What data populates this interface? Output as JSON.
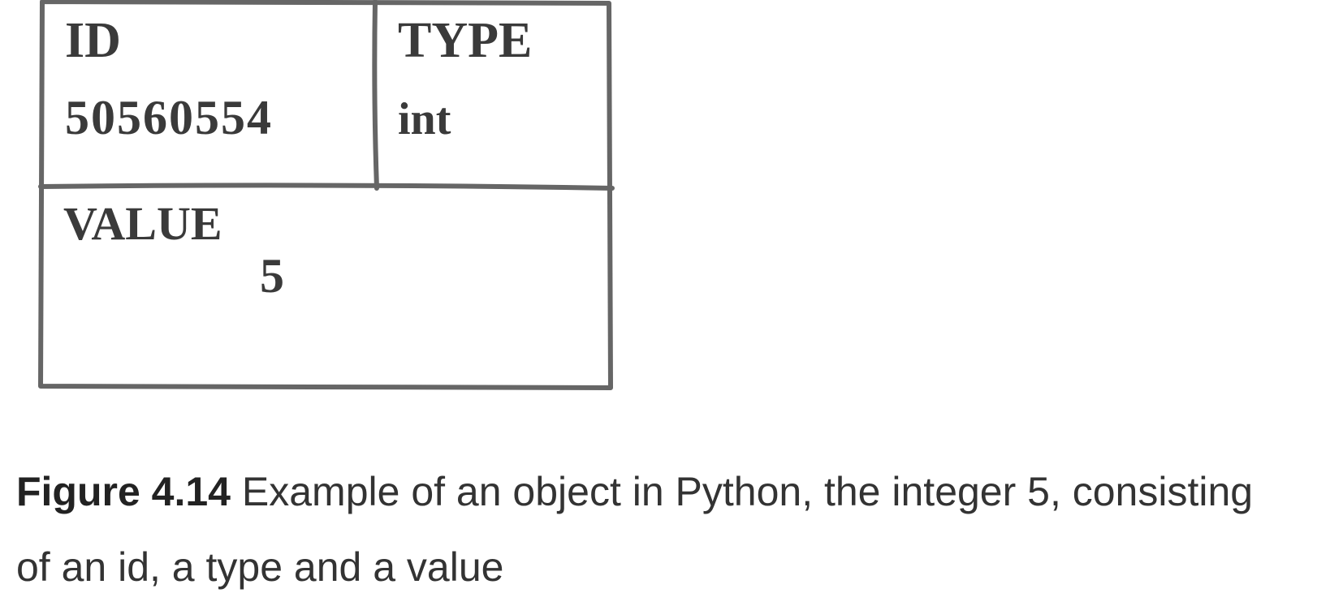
{
  "diagram": {
    "id_label": "ID",
    "id_value": "50560554",
    "type_label": "TYPE",
    "type_value": "int",
    "value_label": "VALUE",
    "value_value": "5"
  },
  "caption": {
    "figure_label": "Figure 4.14",
    "text": " Example of an object in Python, the integer 5, consisting of an id, a type and a value"
  }
}
